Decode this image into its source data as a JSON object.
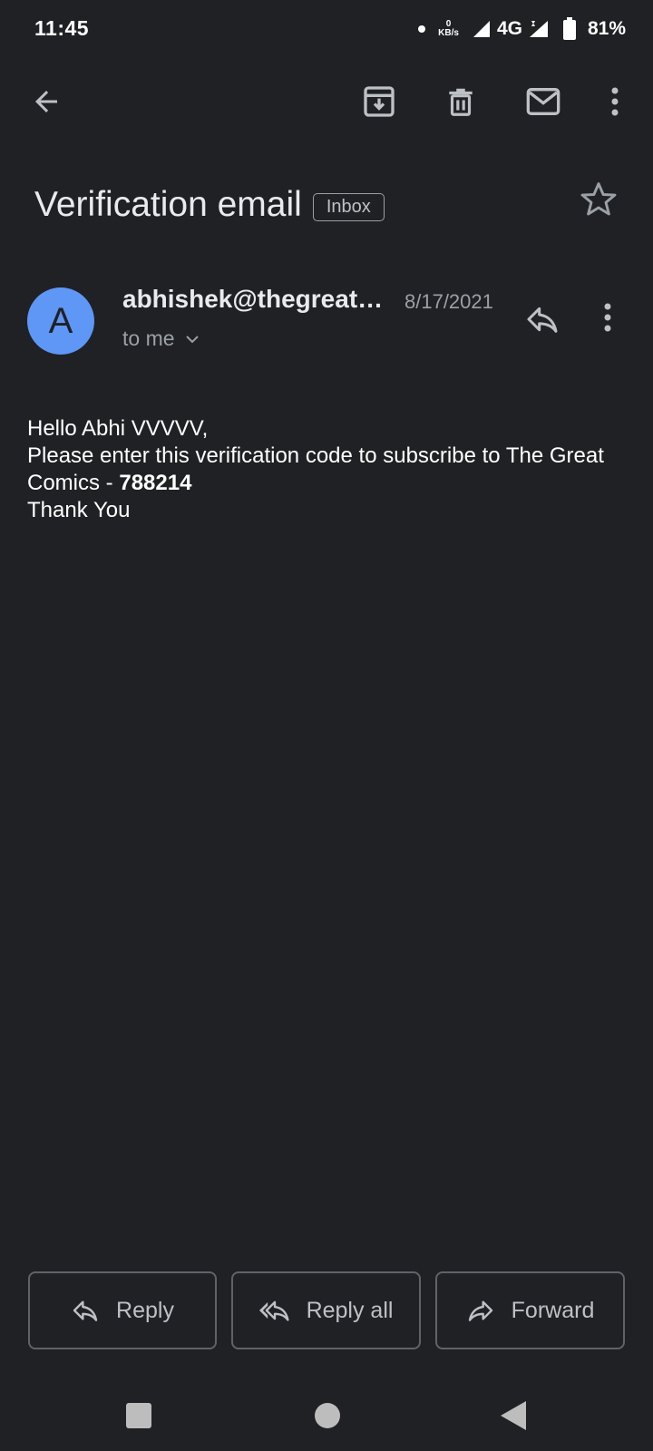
{
  "status_bar": {
    "time": "11:45",
    "net_speed_value": "0",
    "net_speed_unit": "KB/s",
    "network": "4G",
    "battery": "81%"
  },
  "toolbar": {
    "icons": [
      "back-arrow-icon",
      "archive-icon",
      "delete-icon",
      "mark-unread-icon",
      "more-vert-icon"
    ]
  },
  "email": {
    "subject": "Verification email",
    "label": "Inbox",
    "sender_initial": "A",
    "sender": "abhishek@thegreat…",
    "date": "8/17/2021",
    "recipient": "to me",
    "body": {
      "line1": "Hello Abhi VVVVV,",
      "line2_prefix": "Please enter this verification code to subscribe to The Great Comics - ",
      "code": "788214",
      "line3": "Thank You"
    }
  },
  "actions": {
    "reply": "Reply",
    "reply_all": "Reply all",
    "forward": "Forward"
  },
  "colors": {
    "background": "#202124",
    "avatar": "#5e97f6",
    "text_primary": "#e8eaed",
    "text_secondary": "#9aa0a6"
  }
}
